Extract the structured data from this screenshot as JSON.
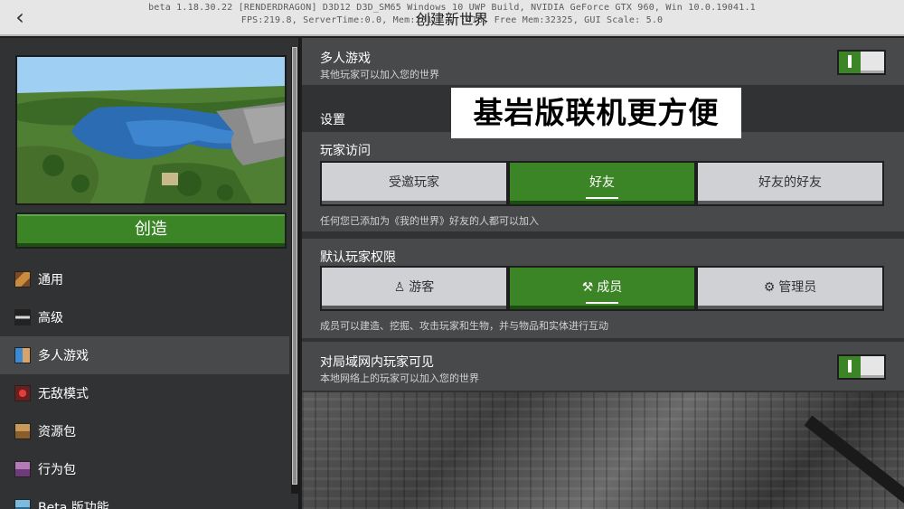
{
  "topbar": {
    "back_label": "‹",
    "debug_line1": "beta 1.18.30.22 [RENDERDRAGON] D3D12 D3D_SM65 Windows 10 UWP Build, NVIDIA GeForce GTX 960, Win 10.0.19041.1",
    "debug_line2": "FPS:219.8, ServerTime:0.0, Mem:231 ... :418, Free Mem:32325, GUI Scale: 5.0",
    "title": "创建新世界"
  },
  "left": {
    "create_label": "创造",
    "nav": [
      {
        "label": "通用",
        "icon": "gear-icon"
      },
      {
        "label": "高级",
        "icon": "advanced-icon"
      },
      {
        "label": "多人游戏",
        "icon": "multiplayer-icon"
      },
      {
        "label": "无敌模式",
        "icon": "cheats-icon"
      },
      {
        "label": "资源包",
        "icon": "resource-pack-icon"
      },
      {
        "label": "行为包",
        "icon": "behavior-pack-icon"
      },
      {
        "label": "Beta 版功能",
        "icon": "beta-icon"
      }
    ]
  },
  "right": {
    "multiplayer": {
      "title": "多人游戏",
      "subtitle": "其他玩家可以加入您的世界",
      "toggle_on": true
    },
    "settings_label": "设置",
    "player_access": {
      "title": "玩家访问",
      "options": [
        "受邀玩家",
        "好友",
        "好友的好友"
      ],
      "selected": "好友",
      "description": "任何您已添加为《我的世界》好友的人都可以加入"
    },
    "default_permission": {
      "title": "默认玩家权限",
      "options": [
        "游客",
        "成员",
        "管理员"
      ],
      "selected": "成员",
      "description": "成员可以建造、挖掘、攻击玩家和生物，并与物品和实体进行互动"
    },
    "lan": {
      "title": "对局域网内玩家可见",
      "subtitle": "本地网络上的玩家可以加入您的世界",
      "toggle_on": true
    }
  },
  "overlay_caption": "基岩版联机更方便",
  "colors": {
    "accent_green": "#3c8527",
    "panel": "#313233",
    "section": "#48494a",
    "button_light": "#d0d1d4"
  }
}
